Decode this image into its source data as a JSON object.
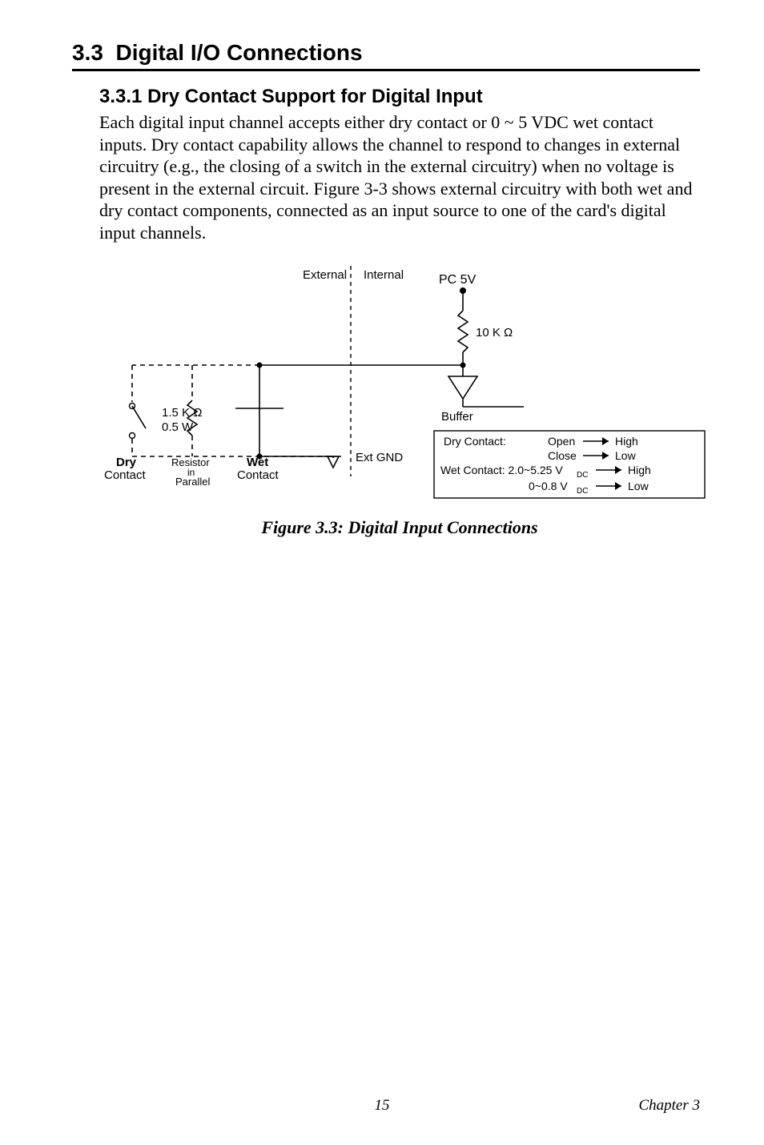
{
  "section": {
    "number": "3.3",
    "title": "Digital I/O Connections"
  },
  "subsection": {
    "number": "3.3.1",
    "title": "Dry Contact Support for Digital Input"
  },
  "body": "Each digital input channel accepts either dry contact or 0 ~ 5 VDC wet contact inputs. Dry contact capability allows the channel to respond to changes in external circuitry (e.g., the closing of a switch in the external circuitry) when no voltage is present in the external circuit. Figure 3-3 shows external circuitry with both wet and dry contact components, connected as an input source to one of the card's digital input channels.",
  "figure": {
    "caption": "Figure 3.3: Digital Input Connections",
    "labels": {
      "external": "External",
      "internal": "Internal",
      "pc5v": "PC 5V",
      "r10k": "10 K Ω",
      "buffer": "Buffer",
      "r15k": "1.5 K Ω",
      "r05w": "0.5 W",
      "dry_contact_bold": "Dry",
      "dry_contact_text": "Contact",
      "resistor": "Resistor",
      "in": "in",
      "parallel": "Parallel",
      "wet_bold": "Wet",
      "wet_text": "Contact",
      "ext_gnd": "Ext GND",
      "box_dry": "Dry Contact:",
      "box_open": "Open",
      "box_high": "High",
      "box_close": "Close",
      "box_low": "Low",
      "box_wet": "Wet Contact: 2.0~5.25 V",
      "box_dc1": "DC",
      "box_high2": "High",
      "box_range2": "0~0.8 V",
      "box_dc2": "DC",
      "box_low2": "Low"
    }
  },
  "footer": {
    "page": "15",
    "chapter": "Chapter 3"
  }
}
